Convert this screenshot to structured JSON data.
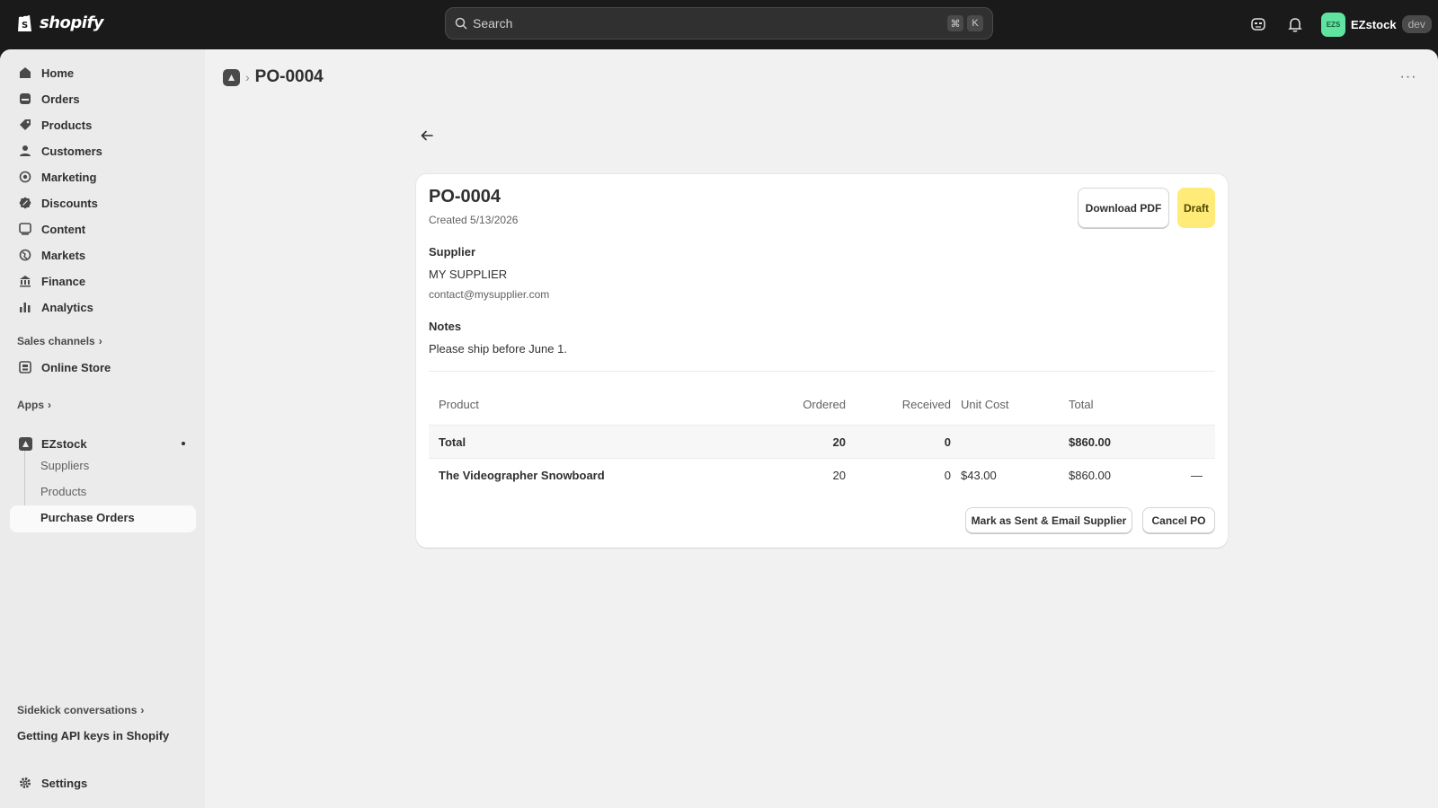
{
  "topbar": {
    "brand": "shopify",
    "search_placeholder": "Search",
    "shortcut_keys": [
      "⌘",
      "K"
    ],
    "store_initials": "EZS",
    "store_name": "EZstock",
    "env_badge": "dev"
  },
  "sidebar": {
    "items": [
      {
        "label": "Home",
        "icon": "home-icon"
      },
      {
        "label": "Orders",
        "icon": "orders-icon"
      },
      {
        "label": "Products",
        "icon": "tag-icon"
      },
      {
        "label": "Customers",
        "icon": "person-icon"
      },
      {
        "label": "Marketing",
        "icon": "target-icon"
      },
      {
        "label": "Discounts",
        "icon": "discount-icon"
      },
      {
        "label": "Content",
        "icon": "content-icon"
      },
      {
        "label": "Markets",
        "icon": "globe-icon"
      },
      {
        "label": "Finance",
        "icon": "bank-icon"
      },
      {
        "label": "Analytics",
        "icon": "bar-chart-icon"
      }
    ],
    "sales_channels_label": "Sales channels",
    "online_store_label": "Online Store",
    "apps_label": "Apps",
    "app_name": "EZstock",
    "app_subitems": [
      "Suppliers",
      "Products",
      "Purchase Orders"
    ],
    "sidekick_label": "Sidekick conversations",
    "sidekick_item": "Getting API keys in Shopify",
    "settings_label": "Settings"
  },
  "header": {
    "breadcrumb_title": "PO-0004"
  },
  "po": {
    "title": "PO-0004",
    "created": "Created 5/13/2026",
    "download_label": "Download PDF",
    "status": "Draft",
    "supplier_label": "Supplier",
    "supplier_name": "MY SUPPLIER",
    "supplier_email": "contact@mysupplier.com",
    "notes_label": "Notes",
    "notes_text": "Please ship before June 1.",
    "table": {
      "headers": {
        "product": "Product",
        "ordered": "Ordered",
        "received": "Received",
        "unit_cost": "Unit Cost",
        "total": "Total"
      },
      "total_row": {
        "label": "Total",
        "ordered": "20",
        "received": "0",
        "total": "$860.00"
      },
      "rows": [
        {
          "product": "The Videographer Snowboard",
          "ordered": "20",
          "received": "0",
          "unit_cost": "$43.00",
          "total": "$860.00",
          "action": "—"
        }
      ]
    },
    "mark_sent_label": "Mark as Sent & Email Supplier",
    "cancel_label": "Cancel PO"
  }
}
